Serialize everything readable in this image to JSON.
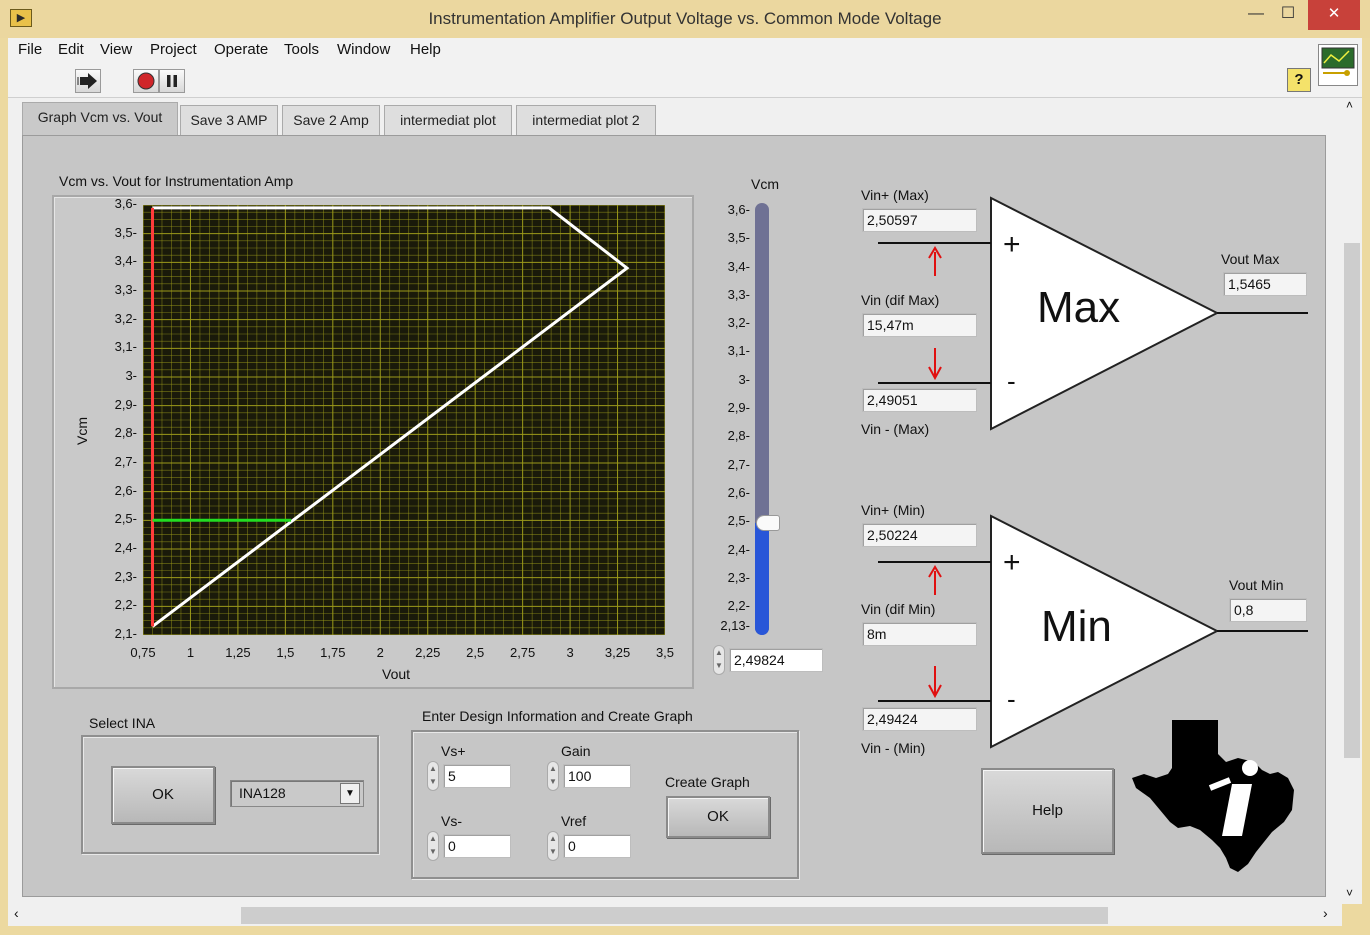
{
  "window": {
    "title": "Instrumentation Amplifier Output Voltage vs. Common Mode Voltage",
    "minimize": "—",
    "maximize": "☐",
    "close": "✕"
  },
  "menu": [
    "File",
    "Edit",
    "View",
    "Project",
    "Operate",
    "Tools",
    "Window",
    "Help"
  ],
  "toolbar": {
    "run_icon": "run-arrow-icon",
    "abort_icon": "abort-icon",
    "pause_icon": "pause-icon",
    "help_label": "?"
  },
  "tabs": [
    "Graph Vcm vs. Vout",
    "Save 3 AMP",
    "Save 2 Amp",
    "intermediat plot",
    "intermediat plot 2"
  ],
  "active_tab": 0,
  "graph": {
    "title": "Vcm vs. Vout for Instrumentation Amp",
    "xlabel": "Vout",
    "ylabel": "Vcm"
  },
  "chart_data": {
    "type": "line",
    "title": "Vcm vs. Vout for Instrumentation Amp",
    "xlabel": "Vout",
    "ylabel": "Vcm",
    "xlim": [
      0.75,
      3.5
    ],
    "ylim": [
      2.1,
      3.6
    ],
    "grid": true,
    "x_ticks": [
      "0,75",
      "1",
      "1,25",
      "1,5",
      "1,75",
      "2",
      "2,25",
      "2,5",
      "2,75",
      "3",
      "3,25",
      "3,5"
    ],
    "y_ticks": [
      "2,1",
      "2,2",
      "2,3",
      "2,4",
      "2,5",
      "2,6",
      "2,7",
      "2,8",
      "2,9",
      "3",
      "3,1",
      "3,2",
      "3,3",
      "3,4",
      "3,5",
      "3,6"
    ],
    "series": [
      {
        "color": "#ffffff",
        "x": [
          0.8,
          3.3,
          2.89,
          0.8
        ],
        "y": [
          2.13,
          3.38,
          3.59,
          3.59
        ]
      },
      {
        "color": "#ff3b3b",
        "x": [
          0.8,
          0.8
        ],
        "y": [
          2.13,
          3.59
        ]
      },
      {
        "color": "#22dd22",
        "x": [
          0.8,
          1.53
        ],
        "y": [
          2.5,
          2.5
        ]
      }
    ]
  },
  "vcm_slider": {
    "label": "Vcm",
    "ticks": [
      "3,6",
      "3,5",
      "3,4",
      "3,3",
      "3,2",
      "3,1",
      "3",
      "2,9",
      "2,8",
      "2,7",
      "2,6",
      "2,5",
      "2,4",
      "2,3",
      "2,2",
      "2,13"
    ],
    "value": 2.49824,
    "min": 2.13,
    "max": 3.6,
    "value_text": "2,49824"
  },
  "select_ina": {
    "label": "Select INA",
    "ok_label": "OK",
    "selected": "INA128"
  },
  "design_info": {
    "label": "Enter Design Information and Create Graph",
    "vs_plus_label": "Vs+",
    "vs_plus": "5",
    "gain_label": "Gain",
    "gain": "100",
    "vs_minus_label": "Vs-",
    "vs_minus": "0",
    "vref_label": "Vref",
    "vref": "0",
    "create_graph_label": "Create Graph",
    "create_ok_label": "OK"
  },
  "amp_max": {
    "name": "Max",
    "vin_plus_label": "Vin+ (Max)",
    "vin_plus": "2,50597",
    "vin_dif_label": "Vin (dif Max)",
    "vin_dif": "15,47m",
    "vin_minus_label": "Vin - (Max)",
    "vin_minus": "2,49051",
    "vout_label": "Vout Max",
    "vout": "1,5465",
    "plus_sign": "+",
    "minus_sign": "-"
  },
  "amp_min": {
    "name": "Min",
    "vin_plus_label": "Vin+ (Min)",
    "vin_plus": "2,50224",
    "vin_dif_label": "Vin (dif Min)",
    "vin_dif": "8m",
    "vin_minus_label": "Vin - (Min)",
    "vin_minus": "2,49424",
    "vout_label": "Vout Min",
    "vout": "0,8",
    "plus_sign": "+",
    "minus_sign": "-"
  },
  "help_button": "Help",
  "logo_icon": "ti-logo-icon",
  "colors": {
    "plot_bg": "#1a1a0a",
    "grid": "#9c9a1a",
    "slider_fill": "#2856d8",
    "slider_track": "#6f7194",
    "arrow": "#e01010"
  }
}
